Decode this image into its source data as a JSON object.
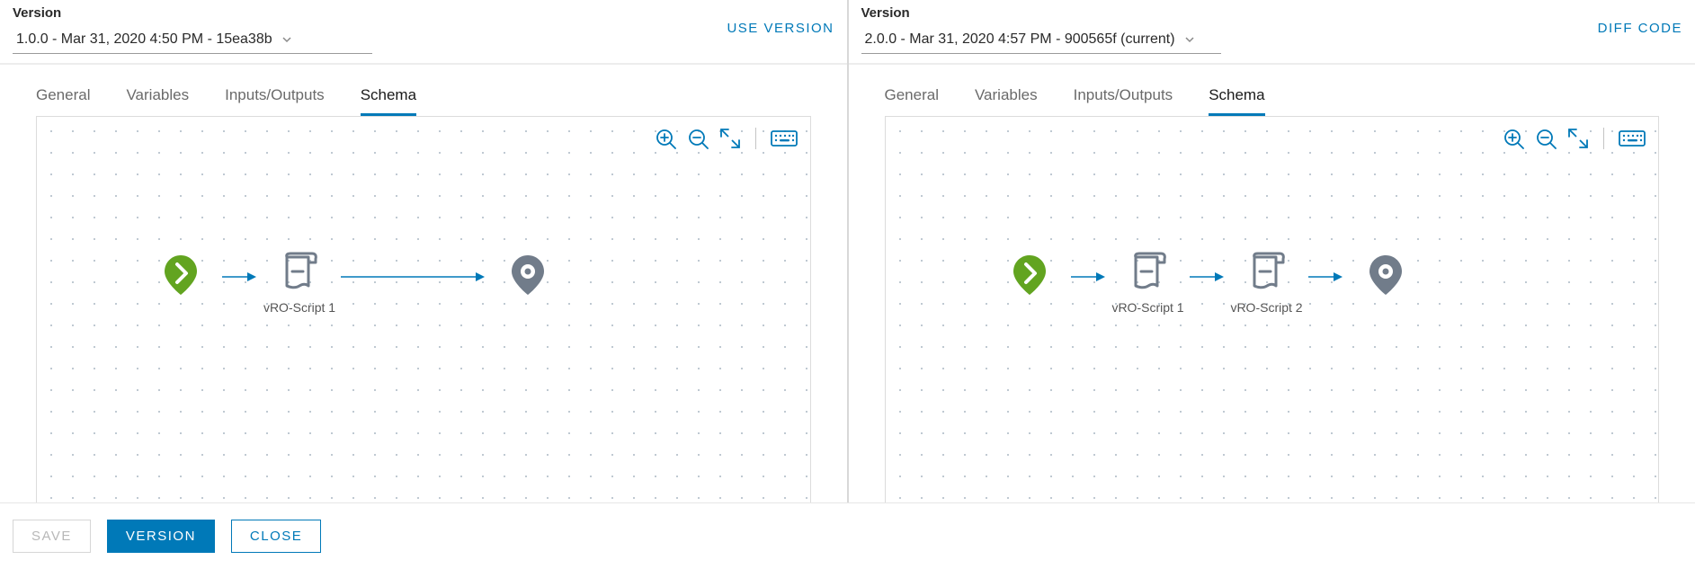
{
  "left": {
    "versionLabel": "Version",
    "versionValue": "1.0.0 - Mar 31, 2020 4:50 PM - 15ea38b",
    "action": "USE VERSION",
    "tabs": {
      "general": "General",
      "variables": "Variables",
      "io": "Inputs/Outputs",
      "schema": "Schema"
    },
    "activeTab": "schema",
    "nodes": [
      {
        "kind": "start"
      },
      {
        "kind": "script",
        "label": "vRO-Script 1"
      },
      {
        "kind": "end"
      }
    ]
  },
  "right": {
    "versionLabel": "Version",
    "versionValue": "2.0.0 - Mar 31, 2020 4:57 PM - 900565f (current)",
    "action": "DIFF CODE",
    "tabs": {
      "general": "General",
      "variables": "Variables",
      "io": "Inputs/Outputs",
      "schema": "Schema"
    },
    "activeTab": "schema",
    "nodes": [
      {
        "kind": "start"
      },
      {
        "kind": "script",
        "label": "vRO-Script 1"
      },
      {
        "kind": "script",
        "label": "vRO-Script 2"
      },
      {
        "kind": "end"
      }
    ]
  },
  "footer": {
    "save": "SAVE",
    "version": "VERSION",
    "close": "CLOSE"
  }
}
